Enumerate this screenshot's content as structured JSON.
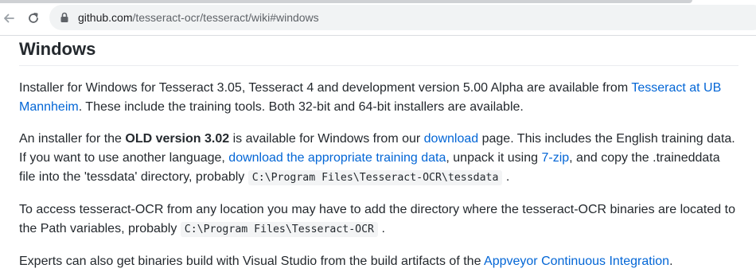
{
  "browser": {
    "url_host": "github.com",
    "url_path": "/tesseract-ocr/tesseract/wiki#windows",
    "icons": {
      "back": "arrow-left-icon",
      "reload": "reload-icon",
      "lock": "lock-icon"
    }
  },
  "page": {
    "heading": "Windows",
    "p1": {
      "text1": "Installer for Windows for Tesseract 3.05, Tesseract 4 and development version 5.00 Alpha are available from ",
      "link1": "Tesseract at UB Mannheim",
      "text2": ". These include the training tools. Both 32-bit and 64-bit installers are available."
    },
    "p2": {
      "text1": "An installer for the ",
      "bold1": "OLD version 3.02",
      "text2": " is available for Windows from our ",
      "link1": "download",
      "text3": " page. This includes the English training data. If you want to use another language, ",
      "link2": "download the appropriate training data",
      "text4": ", unpack it using ",
      "link3": "7-zip",
      "text5": ", and copy the .traineddata file into the 'tessdata' directory, probably ",
      "code1": "C:\\Program Files\\Tesseract-OCR\\tessdata",
      "text6": "."
    },
    "p3": {
      "text1": "To access tesseract-OCR from any location you may have to add the directory where the tesseract-OCR binaries are located to the Path variables, probably ",
      "code1": "C:\\Program Files\\Tesseract-OCR",
      "text2": "."
    },
    "p4": {
      "text1": "Experts can also get binaries build with Visual Studio from the build artifacts of the ",
      "link1": "Appveyor Continuous Integration",
      "text2": "."
    }
  },
  "colors": {
    "link": "#0366d6",
    "text": "#24292e",
    "code_bg": "#f3f4f5",
    "omnibox_bg": "#f1f3f4"
  }
}
